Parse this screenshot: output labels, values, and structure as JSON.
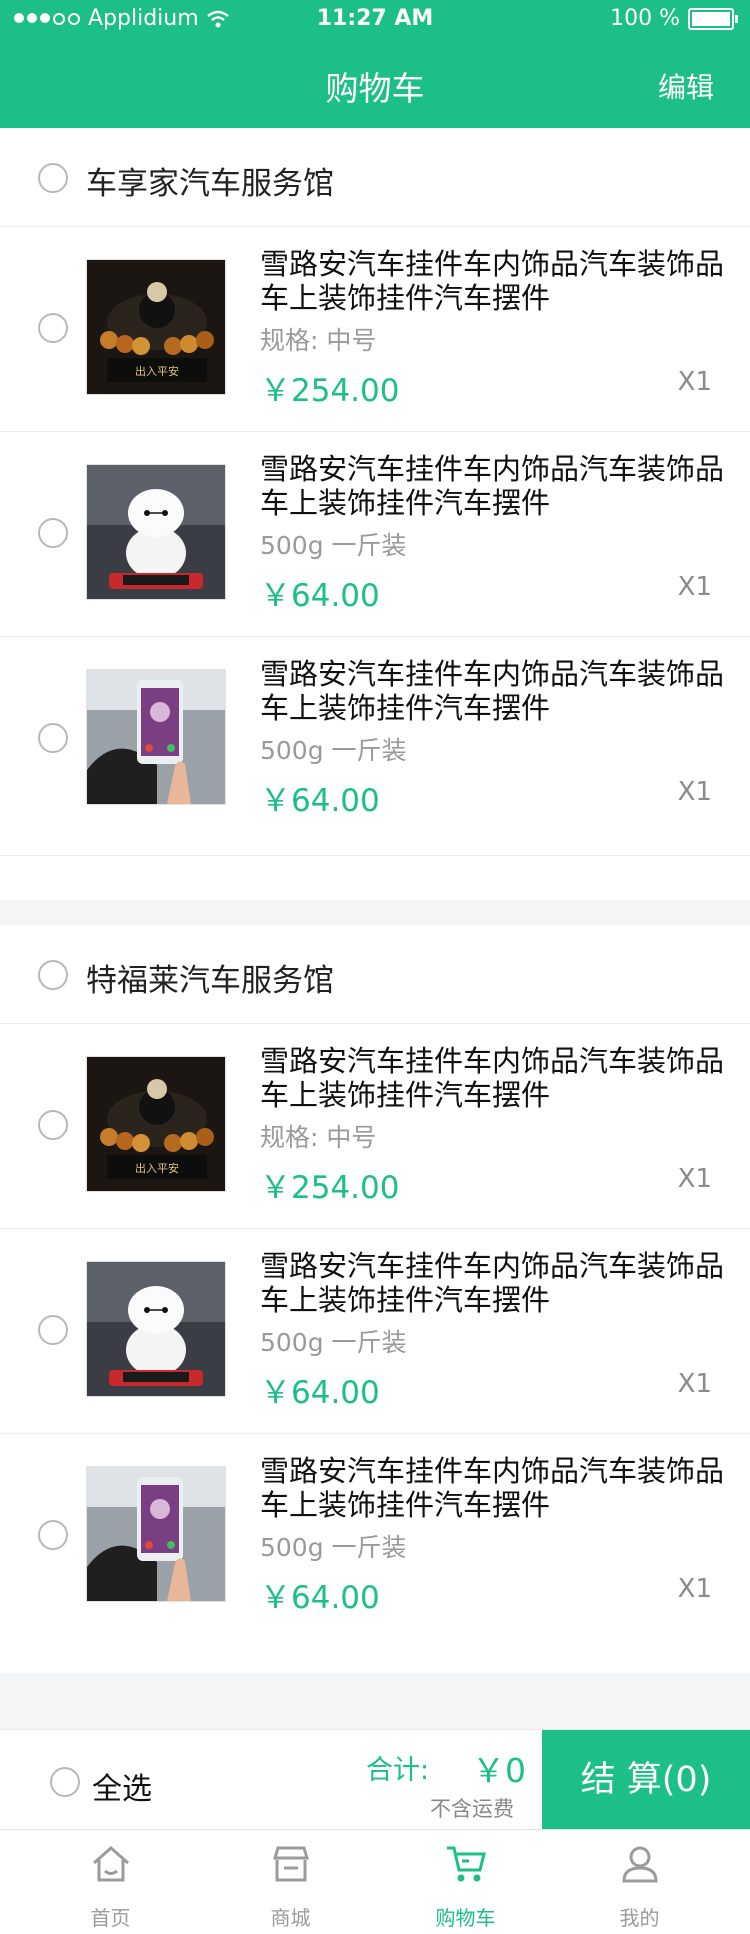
{
  "status_bar": {
    "carrier": "Applidium",
    "time": "11:27 AM",
    "battery": "100 %",
    "icons": [
      "signal-dots-icon",
      "wifi-icon",
      "battery-icon"
    ]
  },
  "header": {
    "title": "购物车",
    "edit_label": "编辑"
  },
  "stores": [
    {
      "name": "车享家汽车服务馆",
      "items": [
        {
          "title": "雪路安汽车挂件车内饰品汽车装饰品 车上装饰挂件汽车摆件",
          "spec": "规格:  中号",
          "price": "￥254.00",
          "qty": "X1",
          "image": "buddha-ornament-image"
        },
        {
          "title": "雪路安汽车挂件车内饰品汽车装饰品 车上装饰挂件汽车摆件",
          "spec": "500g 一斤装",
          "price": "￥64.00",
          "qty": "X1",
          "image": "baymax-doll-image"
        },
        {
          "title": "雪路安汽车挂件车内饰品汽车装饰品 车上装饰挂件汽车摆件",
          "spec": "500g 一斤装",
          "price": "￥64.00",
          "qty": "X1",
          "image": "phone-holder-image"
        }
      ]
    },
    {
      "name": "特福莱汽车服务馆",
      "items": [
        {
          "title": "雪路安汽车挂件车内饰品汽车装饰品 车上装饰挂件汽车摆件",
          "spec": "规格:  中号",
          "price": "￥254.00",
          "qty": "X1",
          "image": "buddha-ornament-image"
        },
        {
          "title": "雪路安汽车挂件车内饰品汽车装饰品 车上装饰挂件汽车摆件",
          "spec": "500g 一斤装",
          "price": "￥64.00",
          "qty": "X1",
          "image": "baymax-doll-image"
        },
        {
          "title": "雪路安汽车挂件车内饰品汽车装饰品 车上装饰挂件汽车摆件",
          "spec": "500g 一斤装",
          "price": "￥64.00",
          "qty": "X1",
          "image": "phone-holder-image"
        }
      ]
    }
  ],
  "footer": {
    "select_all": "全选",
    "total_label": "合计:",
    "total_value": "￥0",
    "shipping_note": "不含运费",
    "checkout_label": "结 算(0)"
  },
  "tabs": [
    {
      "label": "首页",
      "icon": "home-icon",
      "active": false
    },
    {
      "label": "商城",
      "icon": "store-icon",
      "active": false
    },
    {
      "label": "购物车",
      "icon": "cart-icon",
      "active": true
    },
    {
      "label": "我的",
      "icon": "user-icon",
      "active": false
    }
  ],
  "colors": {
    "accent": "#1cbf86",
    "background": "#f4f5f7",
    "divider": "#ececec"
  }
}
